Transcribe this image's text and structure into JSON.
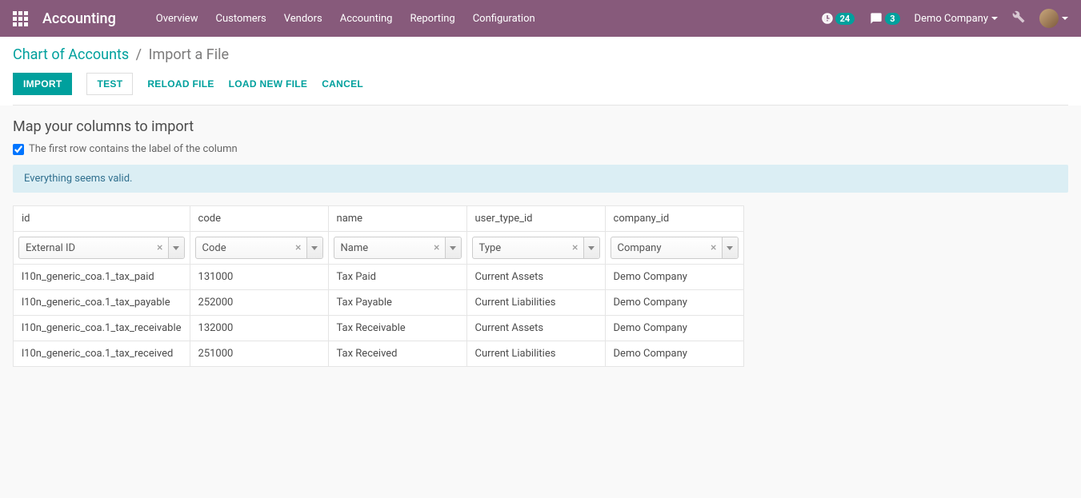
{
  "nav": {
    "brand": "Accounting",
    "links": [
      "Overview",
      "Customers",
      "Vendors",
      "Accounting",
      "Reporting",
      "Configuration"
    ],
    "activity_count": "24",
    "msg_count": "3",
    "company": "Demo Company"
  },
  "breadcrumb": {
    "parent": "Chart of Accounts",
    "current": "Import a File"
  },
  "buttons": {
    "import": "Import",
    "test": "Test",
    "reload": "Reload File",
    "loadnew": "Load New File",
    "cancel": "Cancel"
  },
  "map_title": "Map your columns to import",
  "first_row_label": "The first row contains the label of the column",
  "alert": "Everything seems valid.",
  "columns": [
    {
      "header": "id",
      "mapped": "External ID"
    },
    {
      "header": "code",
      "mapped": "Code"
    },
    {
      "header": "name",
      "mapped": "Name"
    },
    {
      "header": "user_type_id",
      "mapped": "Type"
    },
    {
      "header": "company_id",
      "mapped": "Company"
    }
  ],
  "rows": [
    {
      "id": "l10n_generic_coa.1_tax_paid",
      "code": "131000",
      "name": "Tax Paid",
      "type": "Current Assets",
      "company": "Demo Company"
    },
    {
      "id": "l10n_generic_coa.1_tax_payable",
      "code": "252000",
      "name": "Tax Payable",
      "type": "Current Liabilities",
      "company": "Demo Company"
    },
    {
      "id": "l10n_generic_coa.1_tax_receivable",
      "code": "132000",
      "name": "Tax Receivable",
      "type": "Current Assets",
      "company": "Demo Company"
    },
    {
      "id": "l10n_generic_coa.1_tax_received",
      "code": "251000",
      "name": "Tax Received",
      "type": "Current Liabilities",
      "company": "Demo Company"
    }
  ]
}
